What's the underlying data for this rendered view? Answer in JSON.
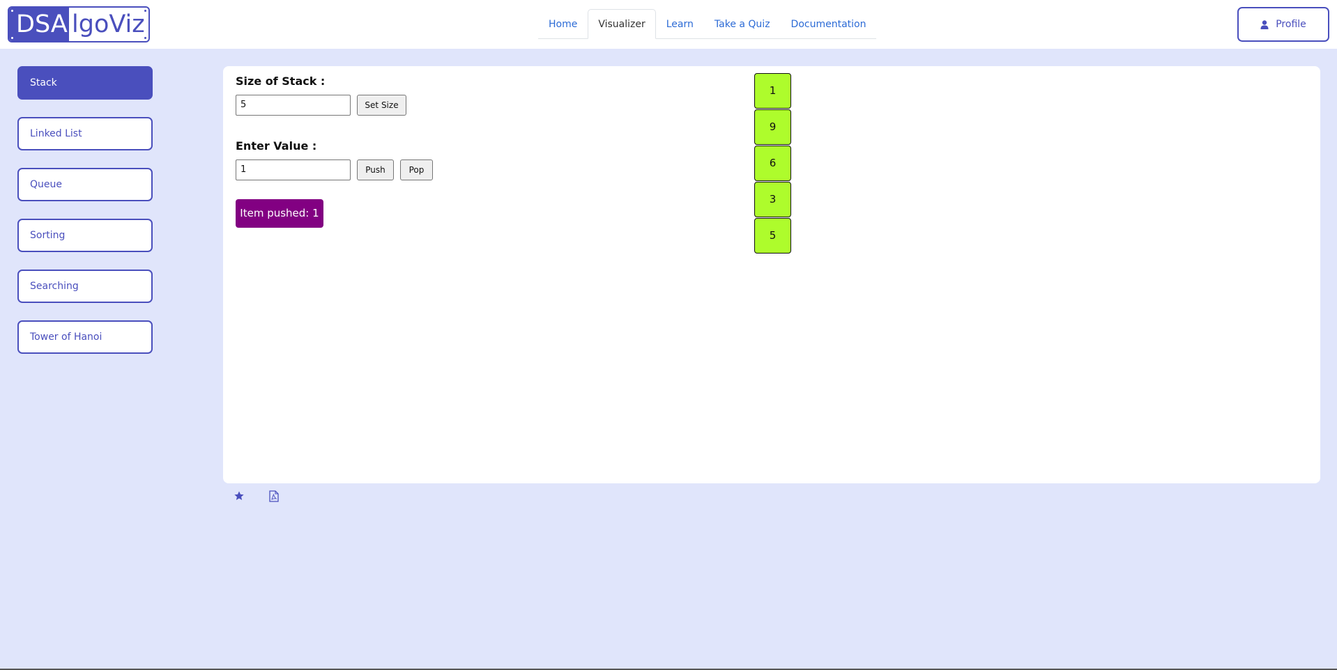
{
  "header": {
    "logo_left": "DSA",
    "logo_right": "lgoViz",
    "nav": [
      {
        "label": "Home"
      },
      {
        "label": "Visualizer",
        "active": true
      },
      {
        "label": "Learn"
      },
      {
        "label": "Take a Quiz"
      },
      {
        "label": "Documentation"
      }
    ],
    "profile_label": "Profile",
    "profile_icon": "user-icon"
  },
  "sidebar": {
    "items": [
      {
        "label": "Stack",
        "active": true
      },
      {
        "label": "Linked List"
      },
      {
        "label": "Queue"
      },
      {
        "label": "Sorting"
      },
      {
        "label": "Searching"
      },
      {
        "label": "Tower of Hanoi"
      }
    ]
  },
  "main": {
    "size_label": "Size of Stack :",
    "size_value": "5",
    "set_size_label": "Set Size",
    "value_label": "Enter Value :",
    "value_value": "1",
    "push_label": "Push",
    "pop_label": "Pop",
    "message": "Item pushed: 1",
    "stack": [
      "1",
      "9",
      "6",
      "3",
      "5"
    ]
  },
  "footer": {
    "icons": [
      "star-icon",
      "pdf-file-icon"
    ]
  },
  "colors": {
    "accent": "#4a4fbd",
    "background": "#e0e5fb",
    "toast": "#820082",
    "stack_cell": "#aefc2c",
    "nav_link": "#2c6bd6"
  }
}
